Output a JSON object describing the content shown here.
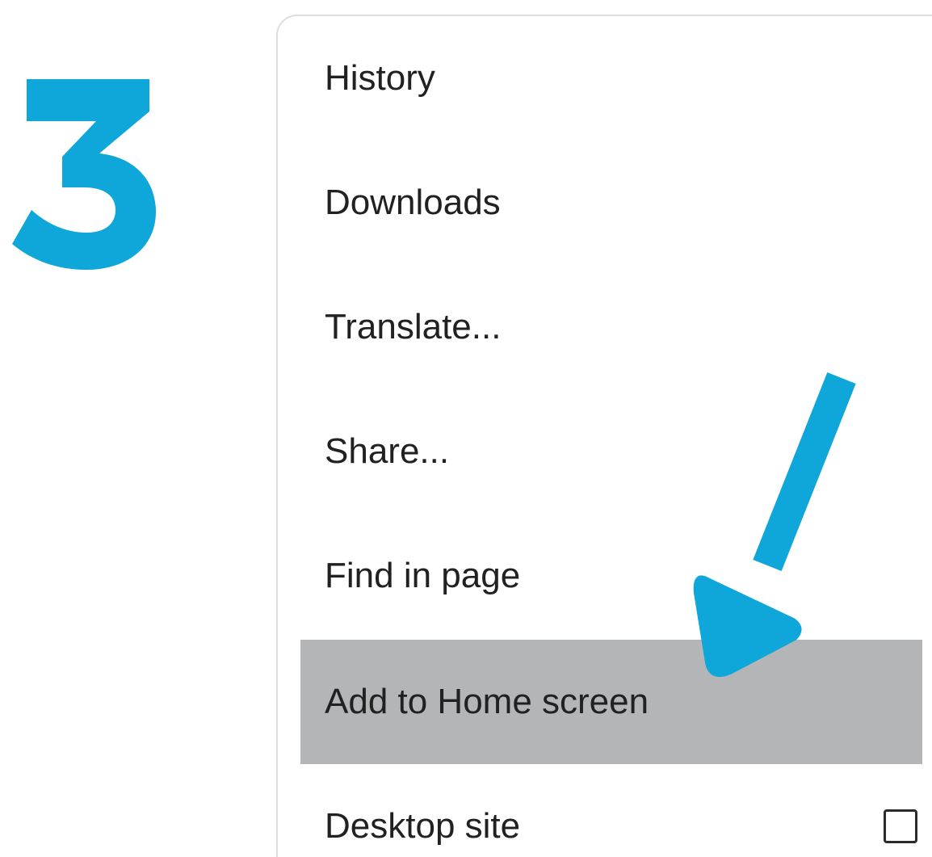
{
  "accent_color": "#0fa6d9",
  "menu": {
    "items": [
      {
        "label": "History"
      },
      {
        "label": "Downloads"
      },
      {
        "label": "Translate..."
      },
      {
        "label": "Share..."
      },
      {
        "label": "Find in page"
      },
      {
        "label": "Add to Home screen",
        "highlighted": true
      },
      {
        "label": "Desktop site",
        "checkbox": {
          "checked": false
        }
      }
    ]
  }
}
